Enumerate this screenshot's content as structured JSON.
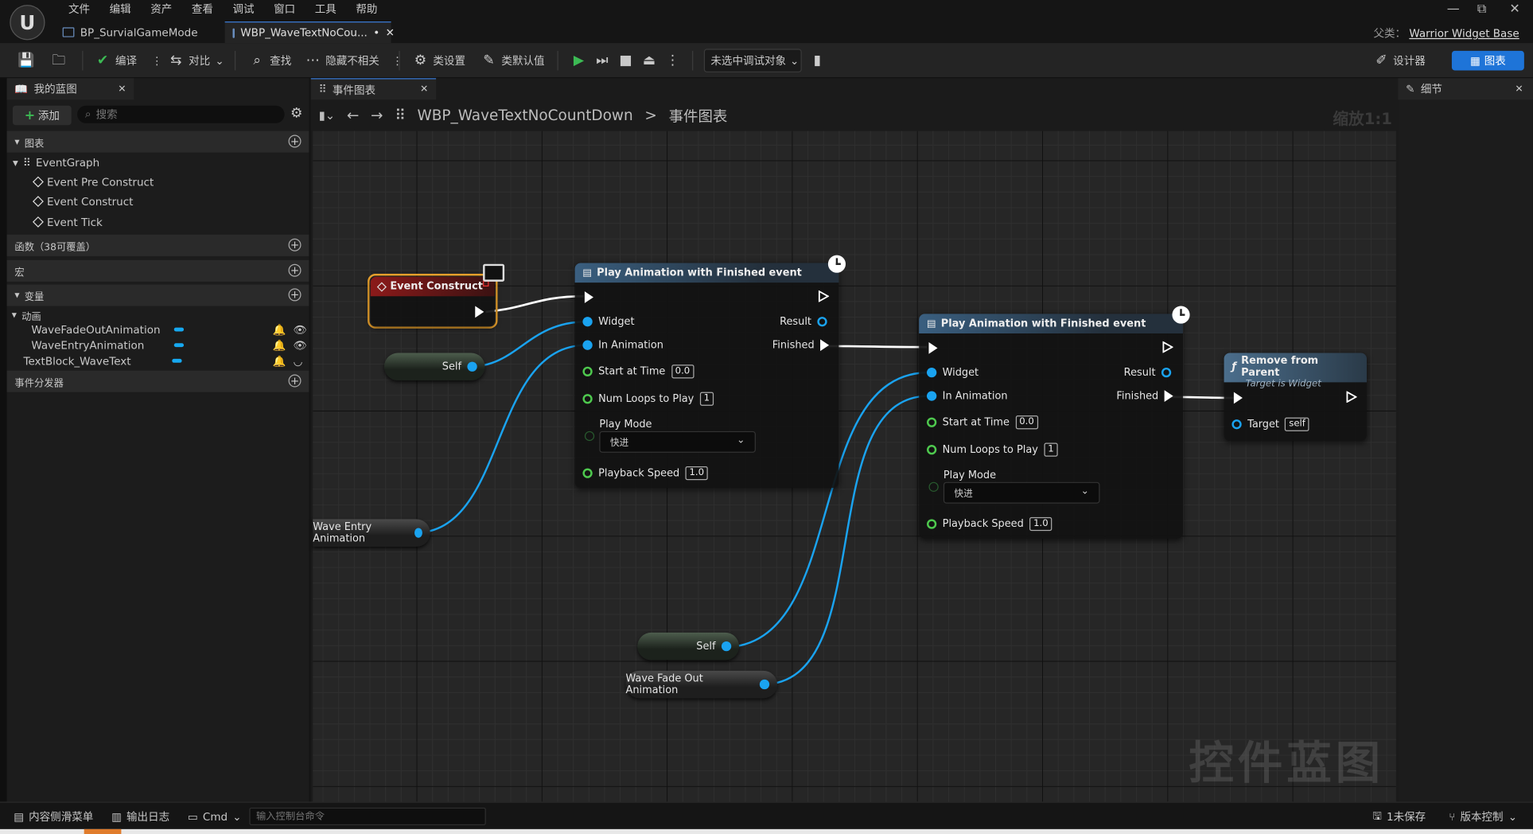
{
  "menu": [
    "文件",
    "编辑",
    "资产",
    "查看",
    "调试",
    "窗口",
    "工具",
    "帮助"
  ],
  "doc_tabs": [
    {
      "label": "BP_SurvialGameMode",
      "active": false
    },
    {
      "label": "WBP_WaveTextNoCou...",
      "active": true
    }
  ],
  "doc_tab_modified": "•",
  "window_controls": {
    "minimize": "—",
    "restore": "⧉",
    "close": "✕"
  },
  "parent_class": {
    "label": "父类：",
    "value": "Warrior Widget Base"
  },
  "toolbar": {
    "compile": "编译",
    "diff": "对比",
    "find": "查找",
    "hide_unrelated": "隐藏不相关",
    "class_settings": "类设置",
    "class_defaults": "类默认值",
    "debug_target": "未选中调试对象",
    "designer": "设计器",
    "graph": "图表"
  },
  "my_blueprint": {
    "tab_label": "我的蓝图",
    "add_label": "添加",
    "search_placeholder": "搜索",
    "sections": {
      "graphs": "图表",
      "functions": "函数（38可覆盖）",
      "macros": "宏",
      "variables": "变量",
      "dispatchers": "事件分发器"
    },
    "event_graph": "EventGraph",
    "events": [
      "Event Pre Construct",
      "Event Construct",
      "Event Tick"
    ],
    "var_category": "动画",
    "variables": [
      "WaveFadeOutAnimation",
      "WaveEntryAnimation",
      "TextBlock_WaveText"
    ]
  },
  "editor": {
    "tab_label": "事件图表",
    "breadcrumb_blueprint": "WBP_WaveTextNoCountDown",
    "breadcrumb_separator": ">",
    "breadcrumb_graph": "事件图表",
    "zoom": "缩放1:1",
    "watermark": "控件蓝图"
  },
  "nodes": {
    "event_construct": {
      "title": "Event Construct"
    },
    "self_1": {
      "label": "Self"
    },
    "self_2": {
      "label": "Self"
    },
    "entry_anim_var": {
      "label": "Wave Entry Animation"
    },
    "fade_anim_var": {
      "label": "Wave Fade Out Animation"
    },
    "play_anim_1": {
      "title": "Play Animation with Finished event",
      "widget": "Widget",
      "in_animation": "In Animation",
      "result": "Result",
      "finished": "Finished",
      "start_at_time": "Start at Time",
      "start_at_time_value": "0.0",
      "num_loops": "Num Loops to Play",
      "num_loops_value": "1",
      "play_mode": "Play Mode",
      "play_mode_value": "快进",
      "playback_speed": "Playback Speed",
      "playback_speed_value": "1.0"
    },
    "play_anim_2": {
      "title": "Play Animation with Finished event",
      "widget": "Widget",
      "in_animation": "In Animation",
      "result": "Result",
      "finished": "Finished",
      "start_at_time": "Start at Time",
      "start_at_time_value": "0.0",
      "num_loops": "Num Loops to Play",
      "num_loops_value": "1",
      "play_mode": "Play Mode",
      "play_mode_value": "快进",
      "playback_speed": "Playback Speed",
      "playback_speed_value": "1.0"
    },
    "remove_from_parent": {
      "title": "Remove from Parent",
      "subtitle": "Target is Widget",
      "target": "Target",
      "target_value": "self"
    }
  },
  "details_panel": {
    "tab_label": "细节"
  },
  "statusbar": {
    "content_drawer": "内容侧滑菜单",
    "output_log": "输出日志",
    "cmd": "Cmd",
    "cmd_placeholder": "输入控制台命令",
    "unsaved": "1未保存",
    "source_control": "版本控制"
  },
  "colors": {
    "accent_blue": "#1e74d8",
    "object_pin": "#1aa3f0",
    "float_pin": "#4ec94e",
    "event_node_header": "#8b1a1a",
    "selection_orange": "#f2a72e"
  }
}
